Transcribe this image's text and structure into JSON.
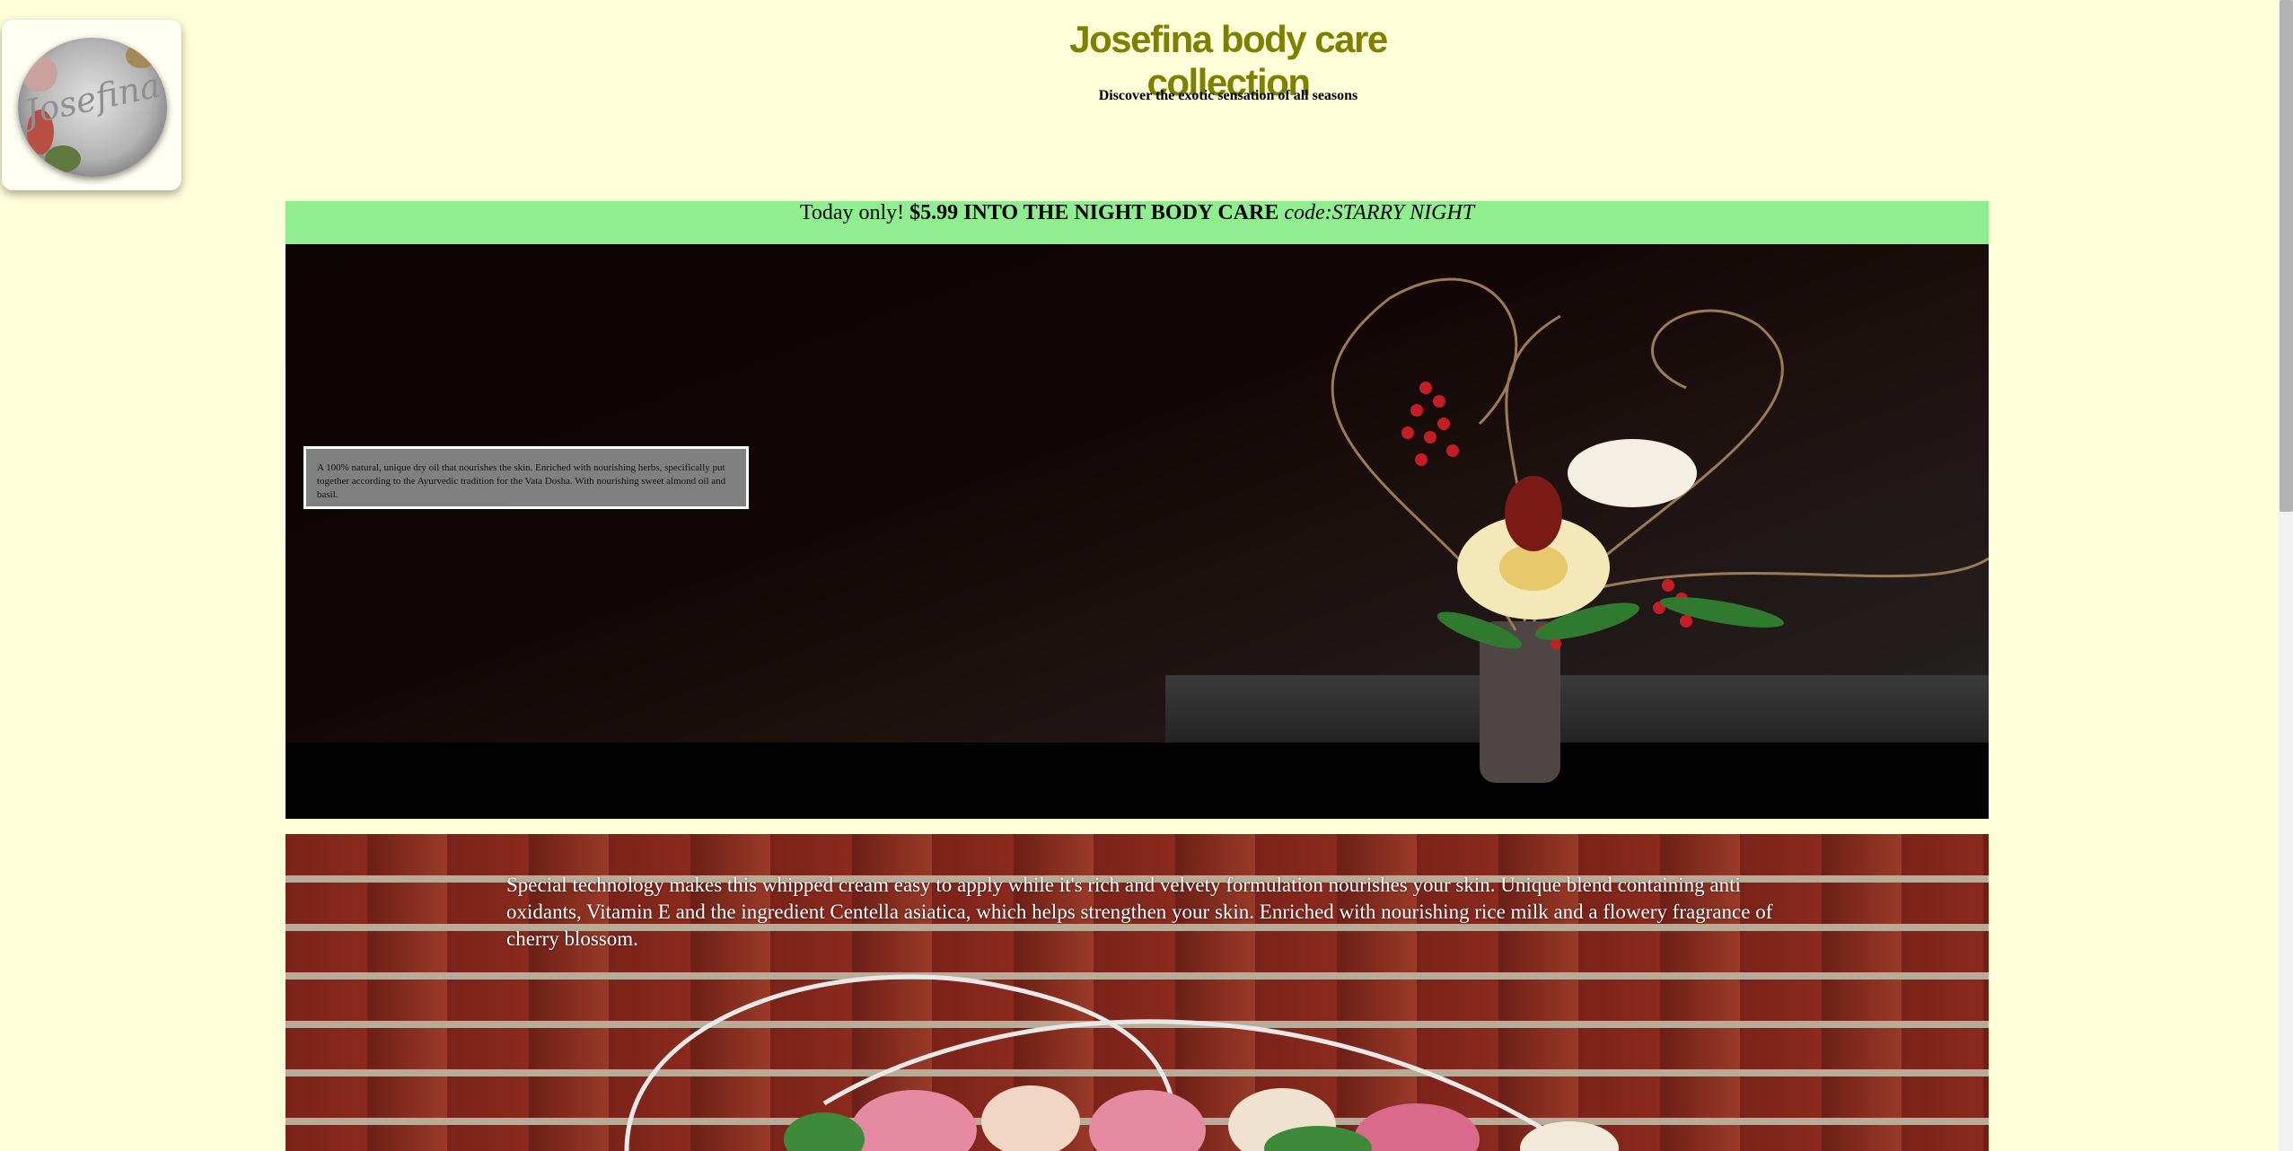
{
  "logo": {
    "text": "Josefina"
  },
  "header": {
    "title": "Josefina body care collection",
    "tagline": "Discover the exotic sensation of all seasons"
  },
  "promo": {
    "prefix": "Today only!",
    "offer": "$5.99 INTO THE NIGHT BODY CARE",
    "code": "code:STARRY NIGHT"
  },
  "product1": {
    "description": "A 100% natural, unique dry oil that nourishes the skin. Enriched with nourishing herbs, specifically put together according to the Ayurvedic tradition for the Vata Dosha. With nourishing sweet almond oil and basil."
  },
  "product2": {
    "description": "Special technology makes this whipped cream easy to apply while it's rich and velvety formulation nourishes your skin. Unique blend containing anti oxidants, Vitamin E and the ingredient Centella asiatica, which helps strengthen your skin. Enriched with nourishing rice milk and a flowery fragrance of cherry blossom."
  },
  "colors": {
    "page_background": "#fefed8",
    "title": "#808000",
    "promo_background": "#90ee90"
  }
}
